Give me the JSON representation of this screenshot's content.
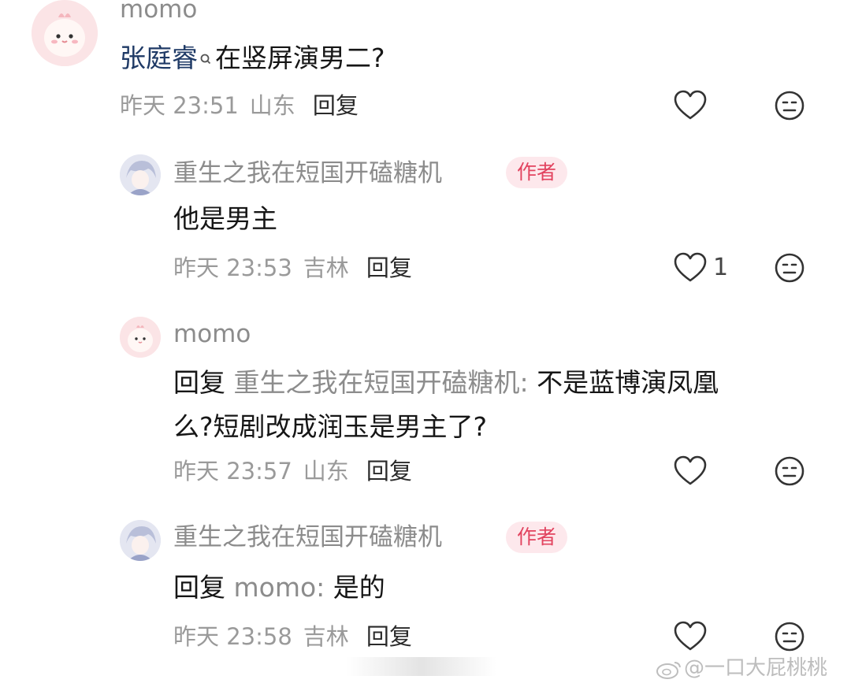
{
  "comments": [
    {
      "username": "momo",
      "mention": "张庭睿",
      "text": "在竖屏演男二?",
      "time": "昨天 23:51",
      "location": "山东",
      "reply_label": "回复",
      "likes": ""
    },
    {
      "username": "重生之我在短国开磕糖机",
      "badge": "作者",
      "text": "他是男主",
      "time": "昨天 23:53",
      "location": "吉林",
      "reply_label": "回复",
      "likes": "1"
    },
    {
      "username": "momo",
      "reply_prefix": "回复",
      "reply_to": "重生之我在短国开磕糖机:",
      "text_line1": "不是蓝博演凤凰",
      "text_line2": "么?短剧改成润玉是男主了?",
      "time": "昨天 23:57",
      "location": "山东",
      "reply_label": "回复",
      "likes": ""
    },
    {
      "username": "重生之我在短国开磕糖机",
      "badge": "作者",
      "reply_prefix": "回复",
      "reply_to": "momo:",
      "text": "是的",
      "time": "昨天 23:58",
      "location": "吉林",
      "reply_label": "回复",
      "likes": ""
    }
  ],
  "watermark": "@一口大屁桃桃",
  "icons": [
    "heart-icon",
    "dislike-face-icon",
    "search-icon",
    "weibo-logo-icon"
  ],
  "colors": {
    "badge_bg": "#fde8ec",
    "badge_text": "#e2435f",
    "meta": "#9a9a9a",
    "username": "#8c8c8c",
    "mention": "#1f3a66"
  }
}
